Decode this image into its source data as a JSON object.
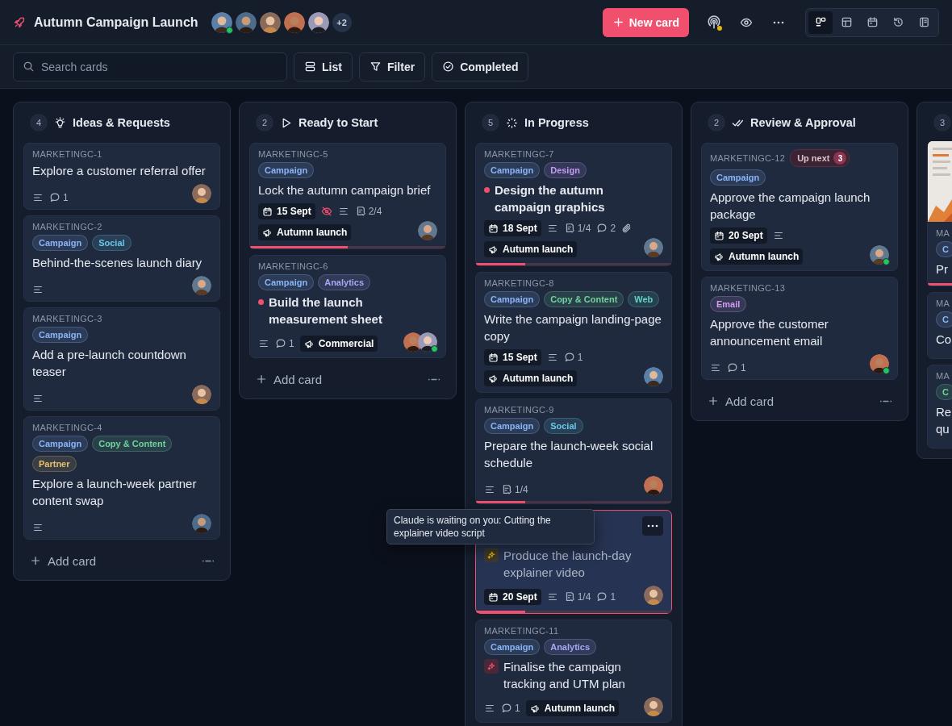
{
  "board": {
    "title": "Autumn Campaign Launch",
    "members": [
      {
        "online": true
      },
      {
        "online": false
      },
      {
        "online": false
      },
      {
        "online": false
      },
      {
        "online": false
      }
    ],
    "more_members": "+2",
    "new_button": "New card",
    "views": [
      {
        "kind": "board",
        "selected": true
      },
      {
        "kind": "table",
        "selected": false
      },
      {
        "kind": "calendar",
        "selected": false
      },
      {
        "kind": "history",
        "selected": false
      },
      {
        "kind": "docs",
        "selected": false
      }
    ]
  },
  "toolbar": {
    "search": {
      "placeholder": "Search cards"
    },
    "buttons": [
      {
        "kind": "list",
        "label": "List"
      },
      {
        "kind": "filter",
        "label": "Filter"
      },
      {
        "kind": "completed",
        "label": "Completed"
      }
    ]
  },
  "columns": [
    {
      "count": "4",
      "kind": "bulb",
      "title": "Ideas & Requests",
      "add_label": "Add card",
      "cards": [
        {
          "kind": "plain",
          "id": "MARKETINGC-1",
          "title": "Explore a customer referral offer",
          "meta": [
            {
              "kind": "description"
            },
            {
              "kind": "comments",
              "text": "1"
            }
          ],
          "assignees": [
            {
              "online": false
            }
          ]
        },
        {
          "kind": "plain",
          "id": "MARKETINGC-2",
          "tags": [
            {
              "label": "Campaign",
              "color": "#8ab4f8"
            },
            {
              "label": "Social",
              "color": "#67c7e8"
            }
          ],
          "title": "Behind-the-scenes launch diary",
          "meta": [
            {
              "kind": "description"
            }
          ],
          "assignees": [
            {
              "online": false
            }
          ]
        },
        {
          "kind": "plain",
          "id": "MARKETINGC-3",
          "tags": [
            {
              "label": "Campaign",
              "color": "#8ab4f8"
            }
          ],
          "title": "Add a pre-launch countdown teaser",
          "meta": [
            {
              "kind": "description"
            }
          ],
          "assignees": [
            {
              "online": false
            }
          ]
        },
        {
          "kind": "plain",
          "id": "MARKETINGC-4",
          "tags": [
            {
              "label": "Campaign",
              "color": "#8ab4f8"
            },
            {
              "label": "Copy & Content",
              "color": "#6fd39a"
            },
            {
              "label": "Partner",
              "color": "#e8c06a"
            }
          ],
          "title": "Explore a launch-week partner content swap",
          "meta": [
            {
              "kind": "description"
            }
          ],
          "assignees": [
            {
              "online": false
            }
          ]
        }
      ]
    },
    {
      "count": "2",
      "kind": "play",
      "title": "Ready to Start",
      "add_label": "Add card",
      "cards": [
        {
          "kind": "plain",
          "id": "MARKETINGC-5",
          "tags": [
            {
              "label": "Campaign",
              "color": "#8ab4f8"
            }
          ],
          "title": "Lock the autumn campaign brief",
          "meta": [
            {
              "kind": "date",
              "text": "15 Sept"
            },
            {
              "kind": "watch"
            },
            {
              "kind": "description"
            },
            {
              "kind": "checklist",
              "text": "2/4"
            },
            {
              "kind": "milestone",
              "text": "Autumn launch"
            }
          ],
          "assignees": [
            {
              "online": false
            }
          ],
          "level": 0.5
        },
        {
          "kind": "priority",
          "id": "MARKETINGC-6",
          "tags": [
            {
              "label": "Campaign",
              "color": "#8ab4f8"
            },
            {
              "label": "Analytics",
              "color": "#a9a6f5"
            }
          ],
          "title": "Build the launch measurement sheet",
          "meta": [
            {
              "kind": "description"
            },
            {
              "kind": "comments",
              "text": "1"
            },
            {
              "kind": "milestone",
              "text": "Commercial"
            }
          ],
          "assignees": [
            {
              "online": false
            },
            {
              "online": true
            }
          ]
        }
      ]
    },
    {
      "count": "5",
      "kind": "progress",
      "title": "In Progress",
      "cards": [
        {
          "kind": "priority",
          "id": "MARKETINGC-7",
          "tags": [
            {
              "label": "Campaign",
              "color": "#8ab4f8"
            },
            {
              "label": "Design",
              "color": "#c39af5"
            }
          ],
          "title": "Design the autumn campaign graphics",
          "meta": [
            {
              "kind": "date",
              "text": "18 Sept"
            },
            {
              "kind": "description"
            },
            {
              "kind": "checklist",
              "text": "1/4"
            },
            {
              "kind": "comments",
              "text": "2"
            },
            {
              "kind": "attachment"
            },
            {
              "kind": "milestone",
              "text": "Autumn launch"
            }
          ],
          "assignees": [
            {
              "online": false
            }
          ],
          "level": 0.25
        },
        {
          "kind": "plain",
          "id": "MARKETINGC-8",
          "tags": [
            {
              "label": "Campaign",
              "color": "#8ab4f8"
            },
            {
              "label": "Copy & Content",
              "color": "#6fd39a"
            },
            {
              "label": "Web",
              "color": "#5fd4c4"
            }
          ],
          "title": "Write the campaign landing-page copy",
          "meta": [
            {
              "kind": "date",
              "text": "15 Sept"
            },
            {
              "kind": "description"
            },
            {
              "kind": "comments",
              "text": "1"
            },
            {
              "kind": "milestone",
              "text": "Autumn launch"
            }
          ],
          "assignees": [
            {
              "online": false
            }
          ]
        },
        {
          "kind": "plain",
          "id": "MARKETINGC-9",
          "tags": [
            {
              "label": "Campaign",
              "color": "#8ab4f8"
            },
            {
              "label": "Social",
              "color": "#67c7e8"
            }
          ],
          "title": "Prepare the launch-week social schedule",
          "meta": [
            {
              "kind": "description"
            },
            {
              "kind": "checklist",
              "text": "1/4"
            }
          ],
          "assignees": [
            {
              "online": false
            }
          ],
          "level": 0.25
        },
        {
          "kind": "agent_waiting",
          "highlighted": true,
          "has_menu": true,
          "tooltip": "Claude is waiting on you: Cutting the explainer video script",
          "title": "Produce the launch-day explainer video",
          "meta": [
            {
              "kind": "date",
              "text": "20 Sept"
            },
            {
              "kind": "description"
            },
            {
              "kind": "checklist",
              "text": "1/4"
            },
            {
              "kind": "comments",
              "text": "1"
            }
          ],
          "assignees": [
            {
              "online": false
            }
          ],
          "level": 0.25
        },
        {
          "kind": "agent_running",
          "id": "MARKETINGC-11",
          "tags": [
            {
              "label": "Campaign",
              "color": "#8ab4f8"
            },
            {
              "label": "Analytics",
              "color": "#a9a6f5"
            }
          ],
          "title": "Finalise the campaign tracking and UTM plan",
          "meta": [
            {
              "kind": "description"
            },
            {
              "kind": "comments",
              "text": "1"
            },
            {
              "kind": "milestone",
              "text": "Autumn launch"
            }
          ],
          "assignees": [
            {
              "online": false
            }
          ]
        }
      ]
    },
    {
      "count": "2",
      "kind": "check-double",
      "title": "Review & Approval",
      "add_label": "Add card",
      "cards": [
        {
          "kind": "plain",
          "id": "MARKETINGC-12",
          "up_next": {
            "label": "Up next",
            "count": "3"
          },
          "tags": [
            {
              "label": "Campaign",
              "color": "#8ab4f8"
            }
          ],
          "title": "Approve the campaign launch package",
          "meta": [
            {
              "kind": "date",
              "text": "20 Sept"
            },
            {
              "kind": "description"
            },
            {
              "kind": "milestone",
              "text": "Autumn launch"
            }
          ],
          "assignees": [
            {
              "online": true
            }
          ]
        },
        {
          "kind": "plain",
          "id": "MARKETINGC-13",
          "tags": [
            {
              "label": "Email",
              "color": "#d49af0"
            }
          ],
          "title": "Approve the customer announcement email",
          "meta": [
            {
              "kind": "description"
            },
            {
              "kind": "comments",
              "text": "1"
            }
          ],
          "assignees": [
            {
              "online": true
            }
          ]
        }
      ]
    },
    {
      "count": "3",
      "cards": [
        {
          "kind": "plain",
          "cover": {
            "kind": "picture"
          },
          "id": "MA",
          "tags": [
            {
              "label": "C",
              "color": "#8ab4f8"
            }
          ],
          "title": "Pr",
          "level": 1
        },
        {
          "kind": "plain",
          "id": "MA",
          "tags": [
            {
              "label": "C",
              "color": "#8ab4f8"
            }
          ],
          "title": "Co"
        },
        {
          "kind": "plain",
          "id": "MA",
          "tags": [
            {
              "label": "C",
              "color": "#6fd39a"
            }
          ],
          "title": "Re\nqu"
        }
      ]
    }
  ]
}
